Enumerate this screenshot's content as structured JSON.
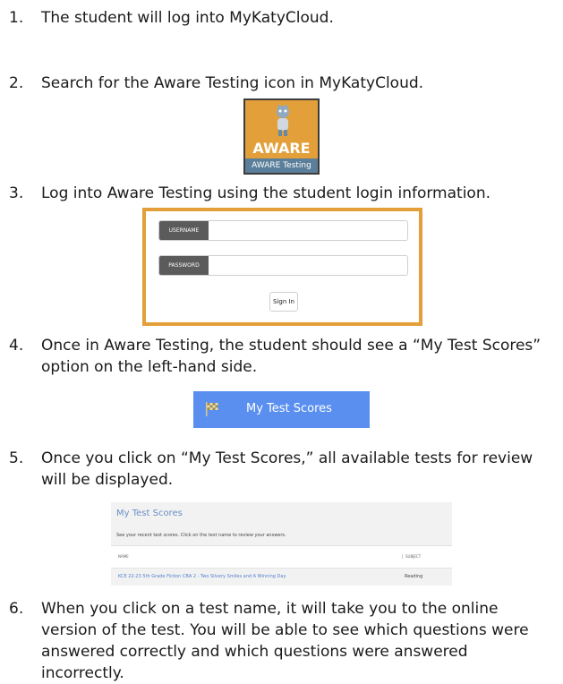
{
  "steps": [
    {
      "num": "1.",
      "text": "The student will log into MyKatyCloud."
    },
    {
      "num": "2.",
      "text": "Search for the Aware Testing icon in MyKatyCloud."
    },
    {
      "num": "3.",
      "text": "Log into Aware Testing using the student login information."
    },
    {
      "num": "4.",
      "text": "Once in Aware Testing, the student should see a “My Test Scores” option on the left-hand side."
    },
    {
      "num": "5.",
      "text": "Once you click on “My Test Scores,” all available tests for review will be displayed."
    },
    {
      "num": "6.",
      "text": "When you click on a test name, it will take you to the online version of the test. You will be able to see which questions were answered correctly and which questions were answered incorrectly."
    }
  ],
  "aware_icon": {
    "word": "AWARE",
    "caption": "AWARE Testing",
    "icon": "mascot-icon"
  },
  "login": {
    "username_label": "USERNAME",
    "password_label": "PASSWORD",
    "sign_in": "Sign In"
  },
  "my_test_scores_button": {
    "label": "My Test Scores",
    "icon": "checkered-flag-icon"
  },
  "scores_panel": {
    "title": "My Test Scores",
    "description": "See your recent test scores. Click on the test name to review your answers.",
    "columns": [
      "NAME",
      "SUBJECT"
    ],
    "rows": [
      {
        "name": "KCE 22-23 5th Grade Fiction CBA 2 - Two Silvery Smiles and A Winning Day",
        "subject": "Reading"
      }
    ]
  },
  "colors": {
    "accent_orange": "#e3a03a",
    "button_blue": "#5a8ff0",
    "link_blue": "#4f7fd0"
  }
}
